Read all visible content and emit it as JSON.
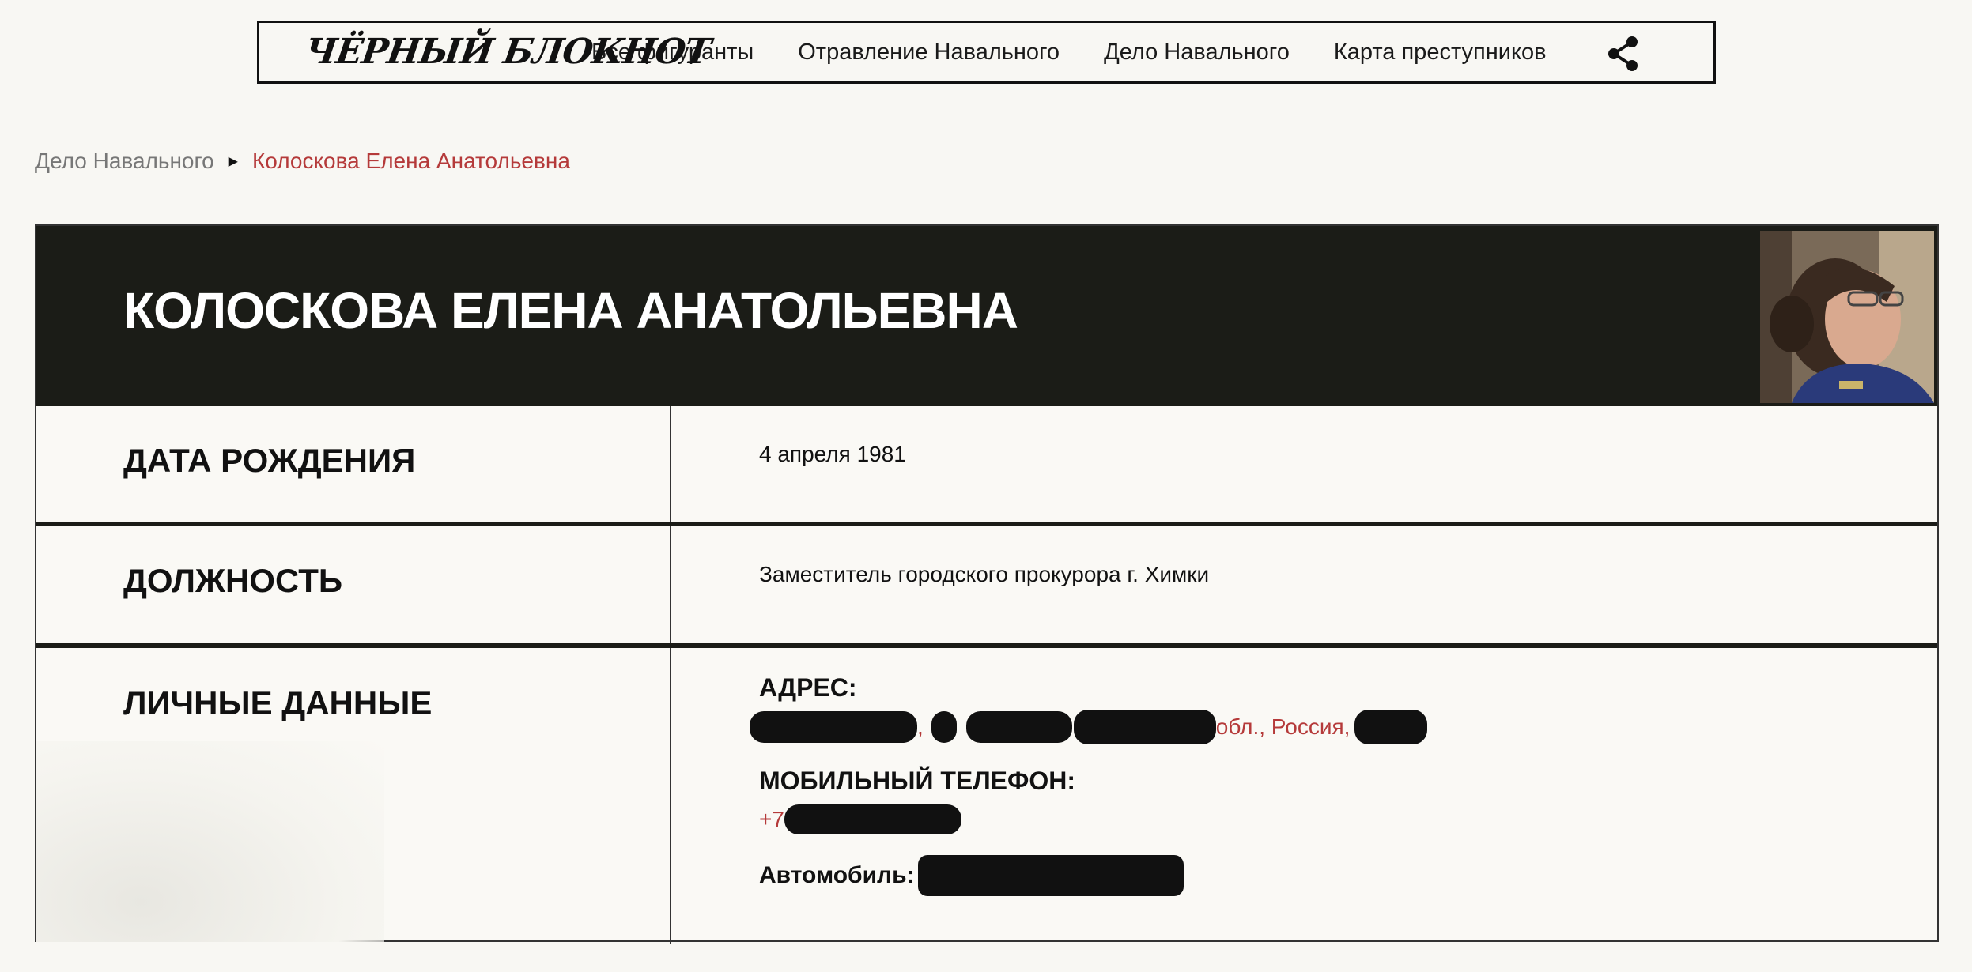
{
  "header": {
    "logo": "ЧЁРНЫЙ БЛОКНОТ",
    "nav": [
      "Все фигуранты",
      "Отравление Навального",
      "Дело Навального",
      "Карта преступников"
    ],
    "share_icon": "share-icon"
  },
  "breadcrumb": {
    "parent": "Дело Навального",
    "current": "Колоскова Елена Анатольевна"
  },
  "profile": {
    "name": "КОЛОСКОВА ЕЛЕНА АНАТОЛЬЕВНА",
    "birth_label": "ДАТА РОЖДЕНИЯ",
    "birth_value": "4 апреля 1981",
    "position_label": "ДОЛЖНОСТЬ",
    "position_value": "Заместитель городского прокурора г. Химки",
    "personal_label": "ЛИЧНЫЕ ДАННЫЕ",
    "address_label": "АДРЕС:",
    "address_visible_sep1": ",",
    "address_visible_tail": "обл., Россия,",
    "phone_label": "МОБИЛЬНЫЙ ТЕЛЕФОН:",
    "phone_prefix": "+7",
    "car_label": "Автомобиль:"
  },
  "colors": {
    "accent": "#b53a3a",
    "dark": "#1b1c17",
    "background": "#f8f7f3"
  }
}
